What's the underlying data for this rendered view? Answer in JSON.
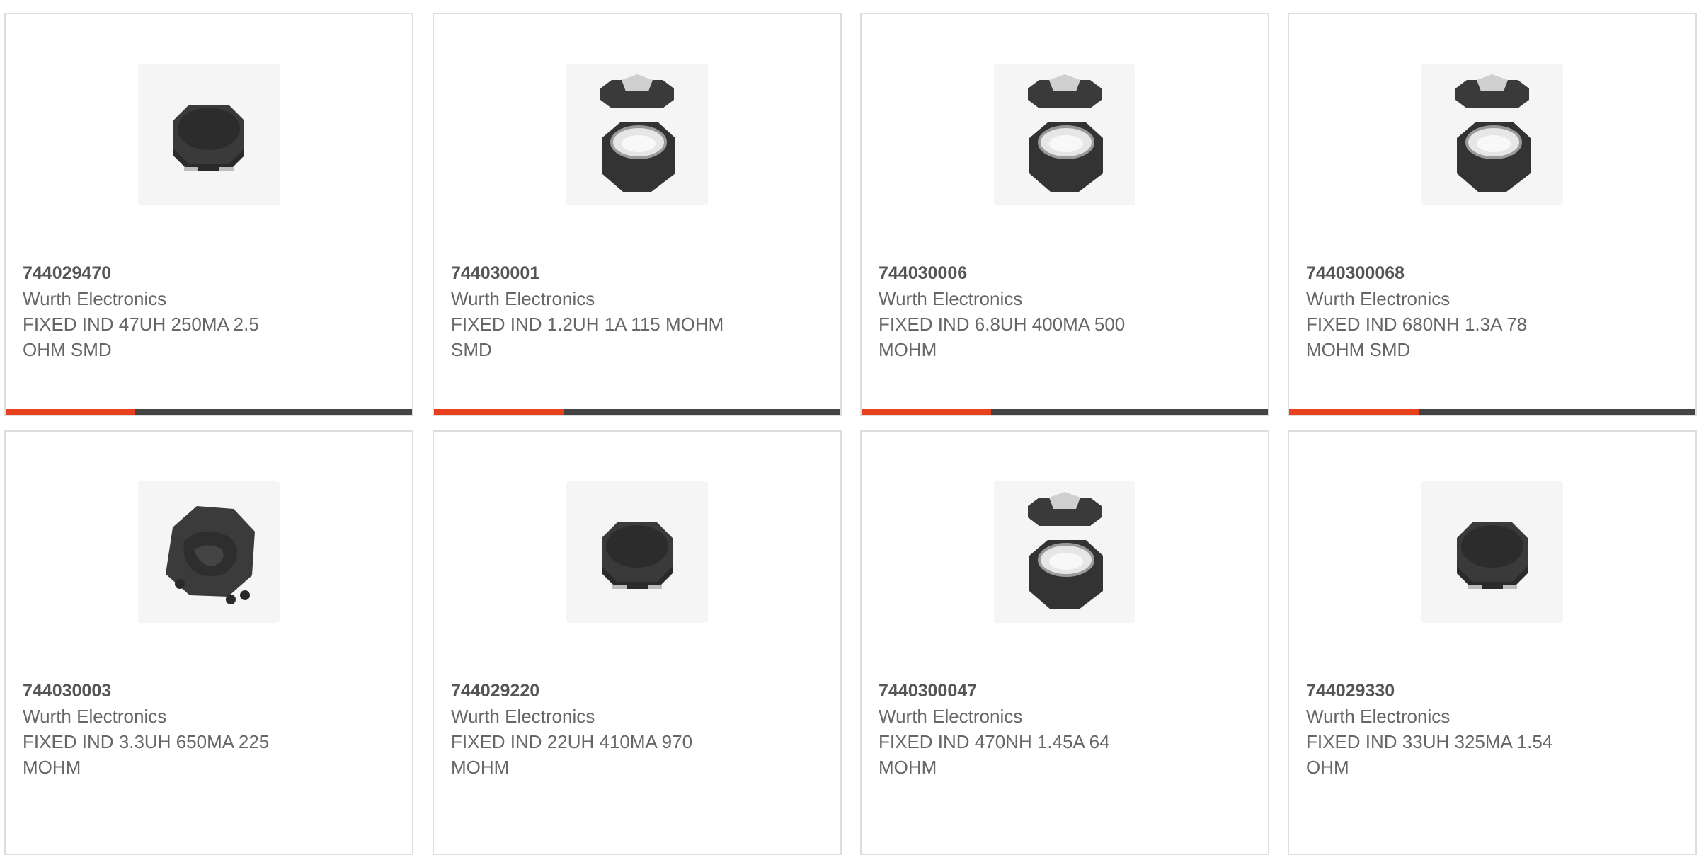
{
  "colors": {
    "accent": "#e8401c",
    "bar_dark": "#444444",
    "card_border": "#dddddd"
  },
  "products": [
    {
      "part_number": "744029470",
      "manufacturer": "Wurth Electronics",
      "desc_line1": "FIXED IND 47UH 250MA 2.5",
      "desc_line2": "OHM SMD",
      "image": "inductor-closed-icon"
    },
    {
      "part_number": "744030001",
      "manufacturer": "Wurth Electronics",
      "desc_line1": "FIXED IND 1.2UH 1A 115 MOHM",
      "desc_line2": "SMD",
      "image": "inductor-exploded-icon"
    },
    {
      "part_number": "744030006",
      "manufacturer": "Wurth Electronics",
      "desc_line1": "FIXED IND 6.8UH 400MA 500",
      "desc_line2": "MOHM",
      "image": "inductor-exploded-icon"
    },
    {
      "part_number": "7440300068",
      "manufacturer": "Wurth Electronics",
      "desc_line1": "FIXED IND 680NH 1.3A 78",
      "desc_line2": "MOHM SMD",
      "image": "inductor-exploded-icon"
    },
    {
      "part_number": "744030003",
      "manufacturer": "Wurth Electronics",
      "desc_line1": "FIXED IND 3.3UH 650MA 225",
      "desc_line2": "MOHM",
      "image": "inductor-rough-icon"
    },
    {
      "part_number": "744029220",
      "manufacturer": "Wurth Electronics",
      "desc_line1": "FIXED IND 22UH 410MA 970",
      "desc_line2": "MOHM",
      "image": "inductor-closed-icon"
    },
    {
      "part_number": "7440300047",
      "manufacturer": "Wurth Electronics",
      "desc_line1": "FIXED IND 470NH 1.45A 64",
      "desc_line2": "MOHM",
      "image": "inductor-exploded-icon"
    },
    {
      "part_number": "744029330",
      "manufacturer": "Wurth Electronics",
      "desc_line1": "FIXED IND 33UH 325MA 1.54",
      "desc_line2": "OHM",
      "image": "inductor-closed-icon"
    }
  ]
}
